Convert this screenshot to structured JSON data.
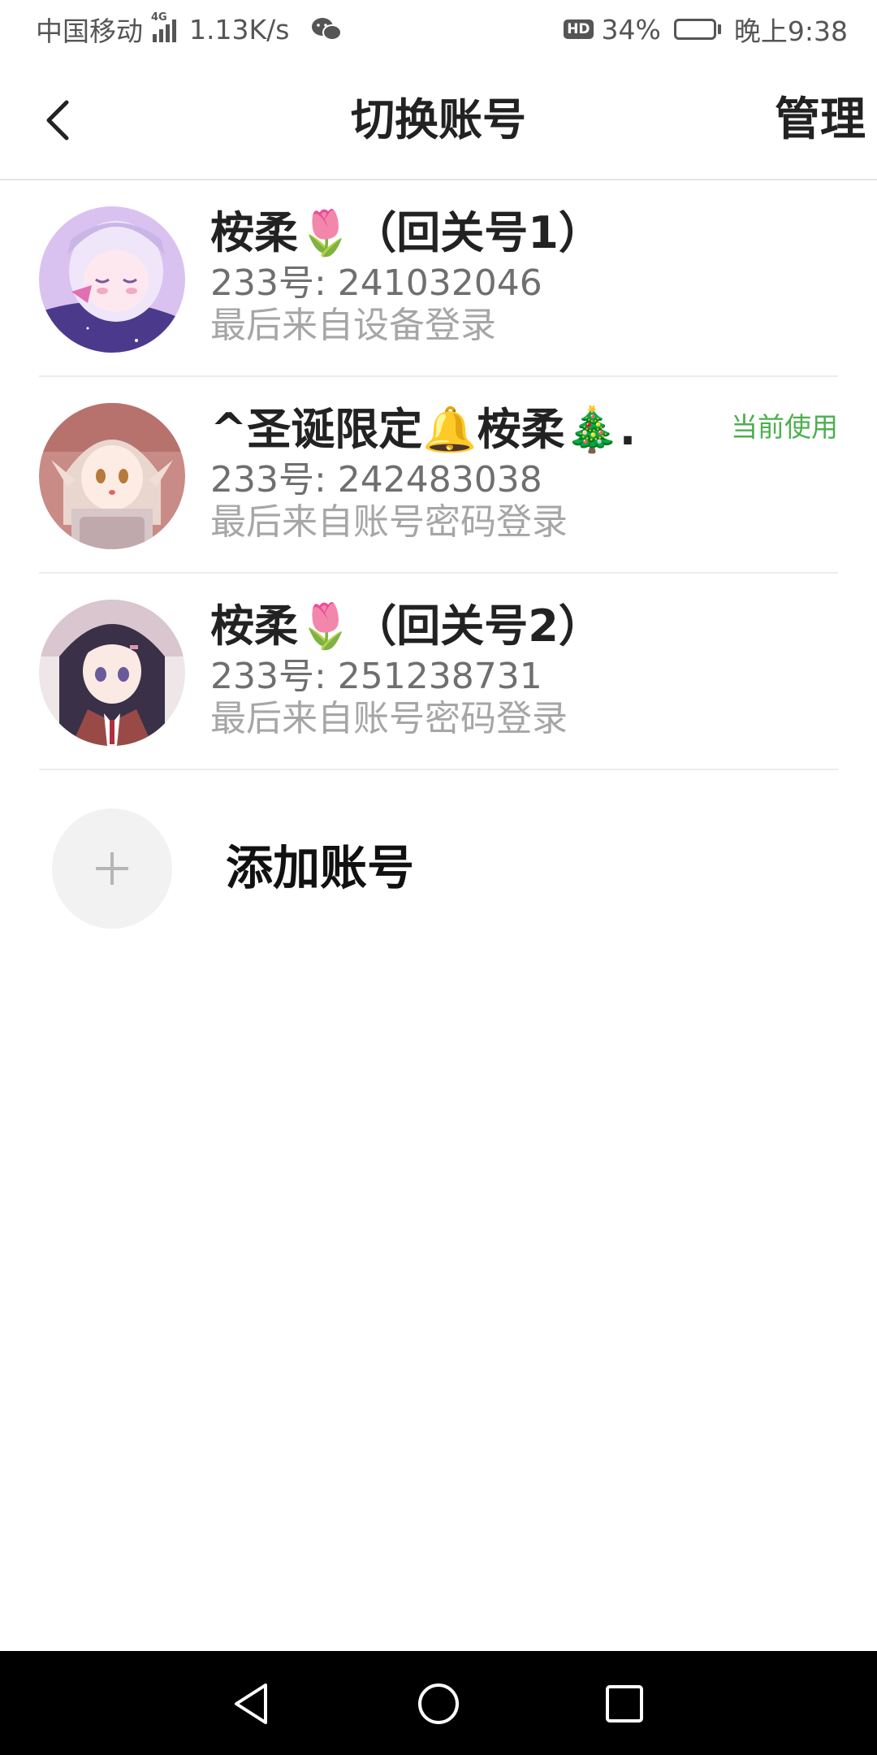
{
  "status_bar": {
    "carrier": "中国移动",
    "network": "4G",
    "speed": "1.13K/s",
    "wechat_icon": "wechat-icon",
    "hd_label": "HD",
    "battery": "34%",
    "battery_level": 0.34,
    "time": "晚上9:38"
  },
  "nav": {
    "back_icon": "back-arrow-icon",
    "title": "切换账号",
    "manage": "管理"
  },
  "accounts": [
    {
      "name": "桉柔🌷（回关号1）",
      "id": "233号: 241032046",
      "login": "最后来自设备登录",
      "current": ""
    },
    {
      "name": "^圣诞限定🔔桉柔🎄.",
      "id": "233号: 242483038",
      "login": "最后来自账号密码登录",
      "current": "当前使用"
    },
    {
      "name": "桉柔🌷（回关号2）",
      "id": "233号: 251238731",
      "login": "最后来自账号密码登录",
      "current": ""
    }
  ],
  "add_account": {
    "icon": "plus-icon",
    "label": "添加账号"
  },
  "colors": {
    "accent_green": "#4caf50",
    "text_primary": "#222222",
    "text_secondary": "#6f6f6f",
    "text_tertiary": "#a6a6a6",
    "divider": "#ececec"
  },
  "system_nav": {
    "back": "triangle-back-icon",
    "home": "circle-home-icon",
    "recents": "square-recents-icon"
  }
}
